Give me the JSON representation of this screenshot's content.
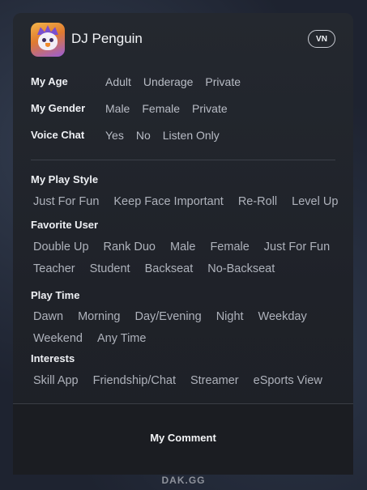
{
  "header": {
    "title": "DJ Penguin",
    "region_badge": "VN",
    "app_icon": "penguin-app-icon"
  },
  "profile": {
    "age": {
      "label": "My Age",
      "options": [
        "Adult",
        "Underage",
        "Private"
      ]
    },
    "gender": {
      "label": "My Gender",
      "options": [
        "Male",
        "Female",
        "Private"
      ]
    },
    "voice": {
      "label": "Voice Chat",
      "options": [
        "Yes",
        "No",
        "Listen Only"
      ]
    }
  },
  "play_style": {
    "label": "My Play Style",
    "tags": [
      "Just For Fun",
      "Keep Face Important",
      "Re-Roll",
      "Level Up"
    ]
  },
  "favorite_user": {
    "label": "Favorite User",
    "tags_row1": [
      "Double Up",
      "Rank Duo",
      "Male",
      "Female",
      "Just For Fun"
    ],
    "tags_row2": [
      "Teacher",
      "Student",
      "Backseat",
      "No-Backseat"
    ]
  },
  "play_time": {
    "label": "Play Time",
    "tags_row1": [
      "Dawn",
      "Morning",
      "Day/Evening",
      "Night",
      "Weekday"
    ],
    "tags_row2": [
      "Weekend",
      "Any Time"
    ]
  },
  "interests": {
    "label": "Interests",
    "tags": [
      "Skill App",
      "Friendship/Chat",
      "Streamer",
      "eSports View"
    ]
  },
  "footer": {
    "comment_label": "My Comment"
  },
  "watermark": "DAK.GG",
  "colors": {
    "card_bg": "#22262d",
    "text": "#eef0f4",
    "muted": "#b0b4bd"
  }
}
